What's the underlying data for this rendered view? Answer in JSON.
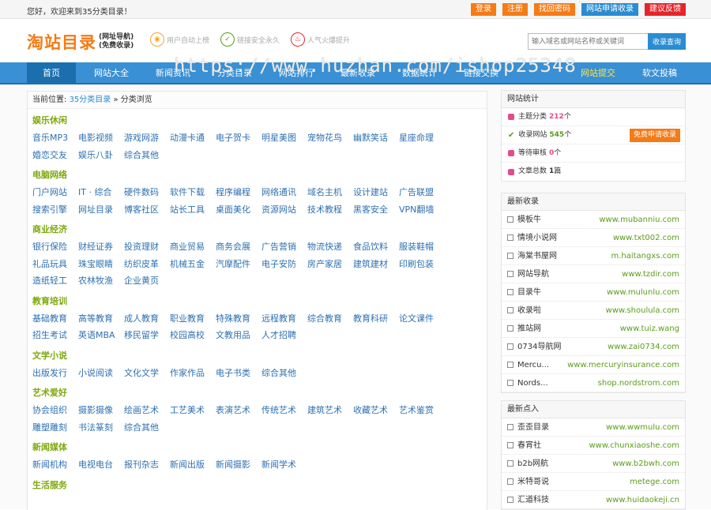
{
  "topbar": {
    "greeting": "您好，欢迎来到35分类目录！",
    "buttons": [
      "登录",
      "注册",
      "找回密码",
      "网站申请收录",
      "建议反馈"
    ]
  },
  "header": {
    "logo_main": "淘站目录",
    "logo_sub1": "(网址导航)",
    "logo_sub2": "(免费收录)",
    "features": [
      "用户自动上榜",
      "链接安全永久",
      "人气火爆提升"
    ],
    "search_placeholder": "输入域名或网站名称或关键词",
    "search_button": "收录查询"
  },
  "nav": {
    "items": [
      "首页",
      "网站大全",
      "新闻资讯",
      "分类目录",
      "网站排行",
      "最新收录",
      "数据统计",
      "链接交换"
    ],
    "right": [
      "网站提交",
      "软文投稿"
    ],
    "watermark": "https://www.huzhan.com/ishop25348"
  },
  "breadcrumb": {
    "label": "当前位置:",
    "home": "35分类目录",
    "sep": "»",
    "current": "分类浏览"
  },
  "categories": [
    {
      "title": "娱乐休闲",
      "links": [
        "音乐MP3",
        "电影视频",
        "游戏网游",
        "动漫卡通",
        "电子贺卡",
        "明星美图",
        "宠物花鸟",
        "幽默笑话",
        "星座命理",
        "婚恋交友",
        "娱乐八卦",
        "综合其他"
      ]
    },
    {
      "title": "电脑网络",
      "links": [
        "门户网站",
        "IT · 综合",
        "硬件数码",
        "软件下载",
        "程序编程",
        "网络通讯",
        "域名主机",
        "设计建站",
        "广告联盟",
        "搜索引擎",
        "网址目录",
        "博客社区",
        "站长工具",
        "桌面美化",
        "资源网站",
        "技术教程",
        "黑客安全",
        "VPN翻墙"
      ]
    },
    {
      "title": "商业经济",
      "links": [
        "银行保险",
        "财经证券",
        "投资理财",
        "商业贸易",
        "商务会展",
        "广告营销",
        "物流快递",
        "食品饮料",
        "服装鞋帽",
        "礼品玩具",
        "珠宝眼睛",
        "纺织皮革",
        "机械五金",
        "汽摩配件",
        "电子安防",
        "房产家居",
        "建筑建材",
        "印刷包装",
        "造纸轻工",
        "农林牧渔",
        "企业黄页"
      ]
    },
    {
      "title": "教育培训",
      "links": [
        "基础教育",
        "高等教育",
        "成人教育",
        "职业教育",
        "特殊教育",
        "远程教育",
        "综合教育",
        "教育科研",
        "论文课件",
        "招生考试",
        "英语MBA",
        "移民留学",
        "校园高校",
        "文教用品",
        "人才招聘"
      ]
    },
    {
      "title": "文学小说",
      "links": [
        "出版发行",
        "小说阅读",
        "文化文学",
        "作家作品",
        "电子书类",
        "综合其他"
      ]
    },
    {
      "title": "艺术爱好",
      "links": [
        "协会组织",
        "摄影摄像",
        "绘画艺术",
        "工艺美术",
        "表演艺术",
        "传统艺术",
        "建筑艺术",
        "收藏艺术",
        "艺术鉴赏",
        "雕塑雕刻",
        "书法篆刻",
        "综合其他"
      ]
    },
    {
      "title": "新闻媒体",
      "links": [
        "新闻机构",
        "电视电台",
        "报刊杂志",
        "新闻出版",
        "新闻摄影",
        "新闻学术"
      ]
    },
    {
      "title": "生活服务",
      "links": []
    }
  ],
  "stats": {
    "title": "网站统计",
    "rows": [
      {
        "label": "主题分类",
        "value": "212",
        "unit": "个",
        "color": "#e54a8c"
      },
      {
        "label": "收录网站",
        "value": "545",
        "unit": "个",
        "color": "#5b9c1a"
      },
      {
        "label": "等待审核",
        "value": "0",
        "unit": "个",
        "color": "#e54a8c"
      },
      {
        "label": "文章总数",
        "value": "1",
        "unit": "篇",
        "color": "#e54a8c"
      }
    ],
    "apply_button": "免费申请收录"
  },
  "latest": {
    "title": "最新收录",
    "rows": [
      {
        "name": "模板牛",
        "url": "www.mubanniu.com"
      },
      {
        "name": "情境小说网",
        "url": "www.txt002.com"
      },
      {
        "name": "海棠书屋网",
        "url": "m.haitangxs.com"
      },
      {
        "name": "网站导航",
        "url": "www.tzdir.com"
      },
      {
        "name": "目录牛",
        "url": "www.mulunlu.com"
      },
      {
        "name": "收录啦",
        "url": "www.shoulula.com"
      },
      {
        "name": "推站网",
        "url": "www.tuiz.wang"
      },
      {
        "name": "0734导航网",
        "url": "www.zai0734.com"
      },
      {
        "name": "Mercu...",
        "url": "www.mercuryinsurance.com"
      },
      {
        "name": "Nords...",
        "url": "shop.nordstrom.com"
      }
    ]
  },
  "hot": {
    "title": "最新点入",
    "rows": [
      {
        "name": "歪歪目录",
        "url": "www.wwmulu.com"
      },
      {
        "name": "春宵社",
        "url": "www.chunxiaoshe.com"
      },
      {
        "name": "b2b网航",
        "url": "www.b2bwh.com"
      },
      {
        "name": "米特哥说",
        "url": "metege.com"
      },
      {
        "name": "汇道科技",
        "url": "www.huidaokeji.cn"
      }
    ]
  }
}
